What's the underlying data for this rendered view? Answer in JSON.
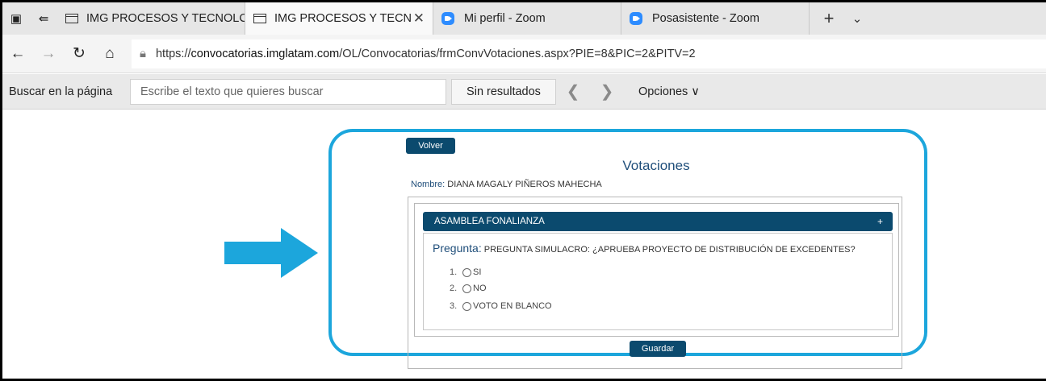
{
  "tabs": [
    {
      "label": "IMG PROCESOS Y TECNOLC",
      "icon": "page-icon",
      "active": false
    },
    {
      "label": "IMG PROCESOS Y TECN",
      "icon": "page-icon",
      "active": true
    },
    {
      "label": "Mi perfil - Zoom",
      "icon": "zoom-icon",
      "active": false
    },
    {
      "label": "Posasistente - Zoom",
      "icon": "zoom-icon",
      "active": false
    }
  ],
  "address": {
    "url_prefix": "https://",
    "url_host": "convocatorias.imglatam.com",
    "url_path": "/OL/Convocatorias/frmConvVotaciones.aspx?PIE=8&PIC=2&PITV=2"
  },
  "findbar": {
    "label": "Buscar en la página",
    "placeholder": "Escribe el texto que quieres buscar",
    "results": "Sin resultados",
    "options": "Opciones ∨"
  },
  "page": {
    "back_button": "Volver",
    "title": "Votaciones",
    "name_label": "Nombre:",
    "name_value": " DIANA MAGALY PIÑEROS MAHECHA",
    "accordion_title": "ASAMBLEA FONALIANZA",
    "accordion_toggle": "+",
    "question_label": "Pregunta:",
    "question_text": " PREGUNTA SIMULACRO: ¿APRUEBA PROYECTO DE DISTRIBUCIÓN DE EXCEDENTES?",
    "options": [
      {
        "num": "1.",
        "label": "SI"
      },
      {
        "num": "2.",
        "label": "NO"
      },
      {
        "num": "3.",
        "label": "VOTO EN BLANCO"
      }
    ],
    "save_button": "Guardar"
  },
  "colors": {
    "primary": "#0b4a6e",
    "highlight": "#1ca6dc",
    "title_text": "#1f4e7a"
  }
}
